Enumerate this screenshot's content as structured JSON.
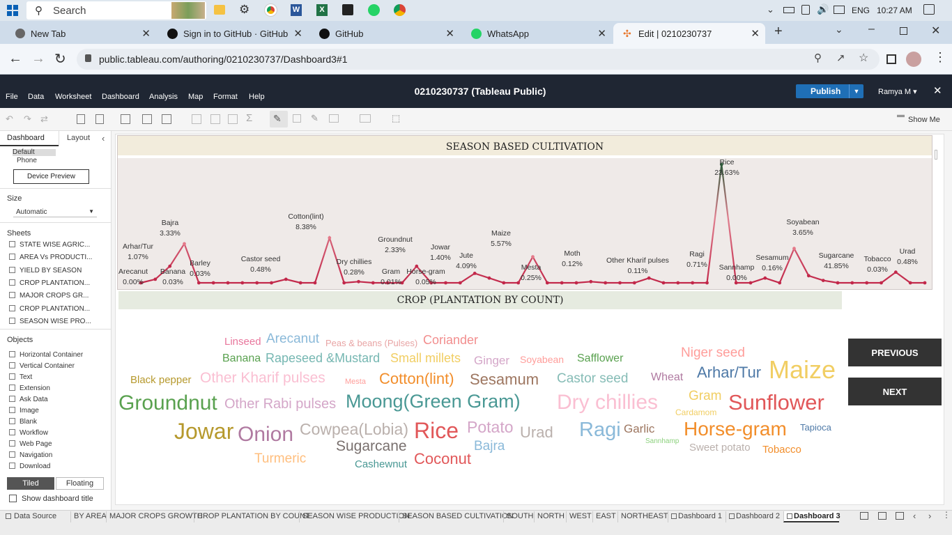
{
  "taskbar": {
    "search": "Search",
    "lang": "ENG",
    "time": "10:27 AM"
  },
  "browser_tabs": [
    {
      "label": "New Tab"
    },
    {
      "label": "Sign in to GitHub · GitHub"
    },
    {
      "label": "GitHub"
    },
    {
      "label": "WhatsApp"
    },
    {
      "label": "Edit | 0210230737"
    }
  ],
  "address": {
    "url": "public.tableau.com/authoring/0210230737/Dashboard3#1"
  },
  "menu": {
    "items": [
      "File",
      "Data",
      "Worksheet",
      "Dashboard",
      "Analysis",
      "Map",
      "Format",
      "Help"
    ],
    "title": "0210230737 (Tableau Public)",
    "publish": "Publish",
    "user": "Ramya M ▾",
    "show_me": "Show Me"
  },
  "left": {
    "tab_dashboard": "Dashboard",
    "tab_layout": "Layout",
    "device_default": "Default",
    "device_phone": "Phone",
    "device_preview": "Device Preview",
    "size_label": "Size",
    "size_value": "Automatic",
    "sheets_label": "Sheets",
    "sheets": [
      "STATE WISE AGRIC...",
      "AREA Vs PRODUCTI...",
      "YIELD BY SEASON",
      "CROP PLANTATION...",
      "MAJOR CROPS GR...",
      "CROP PLANTATION...",
      "SEASON WISE PRO..."
    ],
    "objects_label": "Objects",
    "objects": [
      "Horizontal Container",
      "Vertical Container",
      "Text",
      "Extension",
      "Ask Data",
      "Image",
      "Blank",
      "Workflow",
      "Web Page",
      "Navigation",
      "Download"
    ],
    "tiled": "Tiled",
    "floating": "Floating",
    "show_title": "Show dashboard title"
  },
  "chart_data": {
    "type": "line",
    "title": "SEASON BASED CULTIVATION",
    "labels": [
      {
        "name": "Arecanut",
        "pct": "0.00%"
      },
      {
        "name": "Arhar/Tur",
        "pct": "1.07%"
      },
      {
        "name": "Bajra",
        "pct": "3.33%"
      },
      {
        "name": "Banana",
        "pct": "0.03%"
      },
      {
        "name": "Barley",
        "pct": "0.03%"
      },
      {
        "name": "Castor seed",
        "pct": "0.48%"
      },
      {
        "name": "Cotton(lint)",
        "pct": "8.38%"
      },
      {
        "name": "Dry chillies",
        "pct": "0.28%"
      },
      {
        "name": "Groundnut",
        "pct": "2.33%"
      },
      {
        "name": "Gram",
        "pct": "0.01%"
      },
      {
        "name": "Horse-gram",
        "pct": "0.05%"
      },
      {
        "name": "Jowar",
        "pct": "1.40%"
      },
      {
        "name": "Jute",
        "pct": "4.09%"
      },
      {
        "name": "Maize",
        "pct": "5.57%"
      },
      {
        "name": "Mesta",
        "pct": "0.25%"
      },
      {
        "name": "Moth",
        "pct": "0.12%"
      },
      {
        "name": "Other Kharif pulses",
        "pct": "0.11%"
      },
      {
        "name": "Ragi",
        "pct": "0.71%"
      },
      {
        "name": "Rice",
        "pct": "23.63%"
      },
      {
        "name": "Sannhamp",
        "pct": "0.00%"
      },
      {
        "name": "Sesamum",
        "pct": "0.16%"
      },
      {
        "name": "Soyabean",
        "pct": "3.65%"
      },
      {
        "name": "Sugarcane",
        "pct": "41.85%"
      },
      {
        "name": "Tobacco",
        "pct": "0.03%"
      },
      {
        "name": "Urad",
        "pct": "0.48%"
      }
    ]
  },
  "wordcloud": {
    "title": "CROP (PLANTATION BY COUNT)",
    "words": [
      {
        "t": "Linseed",
        "c": "#e8769c"
      },
      {
        "t": "Arecanut",
        "c": "#8ab9d9"
      },
      {
        "t": "Peas & beans (Pulses)",
        "c": "#e8a4a4"
      },
      {
        "t": "Coriander",
        "c": "#f28e8e"
      },
      {
        "t": "Banana",
        "c": "#59a14f"
      },
      {
        "t": "Rapeseed &Mustard",
        "c": "#76b7b2"
      },
      {
        "t": "Small millets",
        "c": "#f1ce63"
      },
      {
        "t": "Ginger",
        "c": "#d4a6c8"
      },
      {
        "t": "Soyabean",
        "c": "#ff9d9a"
      },
      {
        "t": "Safflower",
        "c": "#59a14f"
      },
      {
        "t": "Niger seed",
        "c": "#ff9d9a"
      },
      {
        "t": "Black pepper",
        "c": "#b6992d"
      },
      {
        "t": "Other Kharif pulses",
        "c": "#fabfd2"
      },
      {
        "t": "Mesta",
        "c": "#ff9d9a"
      },
      {
        "t": "Cotton(lint)",
        "c": "#f28e2b"
      },
      {
        "t": "Sesamum",
        "c": "#9d7660"
      },
      {
        "t": "Castor seed",
        "c": "#86bcb6"
      },
      {
        "t": "Wheat",
        "c": "#b07aa1"
      },
      {
        "t": "Arhar/Tur",
        "c": "#4e79a7"
      },
      {
        "t": "Maize",
        "c": "#f1ce63"
      },
      {
        "t": "Groundnut",
        "c": "#59a14f"
      },
      {
        "t": "Other Rabi pulses",
        "c": "#d4a6c8"
      },
      {
        "t": "Moong(Green Gram)",
        "c": "#499894"
      },
      {
        "t": "Dry chillies",
        "c": "#fabfd2"
      },
      {
        "t": "Gram",
        "c": "#f1ce63"
      },
      {
        "t": "Cardamom",
        "c": "#f1ce63"
      },
      {
        "t": "Sunflower",
        "c": "#e15759"
      },
      {
        "t": "Jowar",
        "c": "#b6992d"
      },
      {
        "t": "Onion",
        "c": "#b07aa1"
      },
      {
        "t": "Cowpea(Lobia)",
        "c": "#bab0ac"
      },
      {
        "t": "Rice",
        "c": "#e15759"
      },
      {
        "t": "Potato",
        "c": "#d4a6c8"
      },
      {
        "t": "Urad",
        "c": "#bab0ac"
      },
      {
        "t": "Ragi",
        "c": "#8ab9d9"
      },
      {
        "t": "Garlic",
        "c": "#9d7660"
      },
      {
        "t": "Horse-gram",
        "c": "#f28e2b"
      },
      {
        "t": "Tapioca",
        "c": "#4e79a7"
      },
      {
        "t": "Sannhamp",
        "c": "#8cd17d"
      },
      {
        "t": "Turmeric",
        "c": "#ffbe7d"
      },
      {
        "t": "Sugarcane",
        "c": "#79706e"
      },
      {
        "t": "Bajra",
        "c": "#8ab9d9"
      },
      {
        "t": "Sweet potato",
        "c": "#bab0ac"
      },
      {
        "t": "Tobacco",
        "c": "#f28e2b"
      },
      {
        "t": "Cashewnut",
        "c": "#499894"
      },
      {
        "t": "Coconut",
        "c": "#e15759"
      }
    ]
  },
  "nav": {
    "previous": "PREVIOUS",
    "next": "NEXT"
  },
  "bottom": {
    "tabs": [
      "Data Source",
      "BY AREA",
      "MAJOR CROPS GROWTH",
      "CROP PLANTATION BY COUNT",
      "SEASON WISE PRODUCTION",
      "SEASON BASED CULTIVATION",
      "SOUTH",
      "NORTH",
      "WEST",
      "EAST",
      "NORTHEAST",
      "Dashboard 1",
      "Dashboard 2",
      "Dashboard 3"
    ]
  },
  "colors": {
    "line": "#c2284a",
    "peak_top": "#2e5a3a",
    "menu_bg": "#1f2633",
    "publish": "#1f6fb6",
    "title_bg": "#f2ecdc",
    "wc_title_bg": "#e6ebe0"
  }
}
